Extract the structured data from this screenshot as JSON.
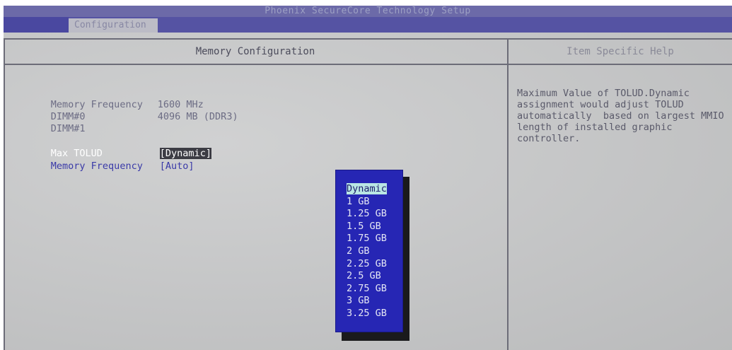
{
  "window": {
    "title": "Phoenix SecureCore Technology Setup"
  },
  "menu": {
    "active_tab": "Configuration"
  },
  "main": {
    "header": "Memory Configuration",
    "info": [
      {
        "label": "Memory Frequency",
        "value": "1600 MHz"
      },
      {
        "label": "DIMM#0",
        "value": "4096 MB (DDR3)"
      },
      {
        "label": "DIMM#1",
        "value": ""
      }
    ],
    "settings": [
      {
        "label": "Max TOLUD",
        "value": "Dynamic"
      },
      {
        "label": "Memory Frequency",
        "value": "[Auto]"
      }
    ]
  },
  "help": {
    "header": "Item Specific Help",
    "text": "Maximum Value of TOLUD.Dynamic\nassignment would adjust TOLUD\nautomatically  based on largest MMIO\nlength of installed graphic\ncontroller."
  },
  "popup": {
    "options": [
      "Dynamic",
      "1 GB",
      "1.25 GB",
      "1.5 GB",
      "1.75 GB",
      "2 GB",
      "2.25 GB",
      "2.5 GB",
      "2.75 GB",
      "3 GB",
      "3.25 GB"
    ],
    "selected": "Dynamic"
  },
  "colors": {
    "menubar": "#5553a3",
    "popup": "#2626b4",
    "highlight": "#b9e6e4",
    "screen": "#c6c7c8"
  }
}
